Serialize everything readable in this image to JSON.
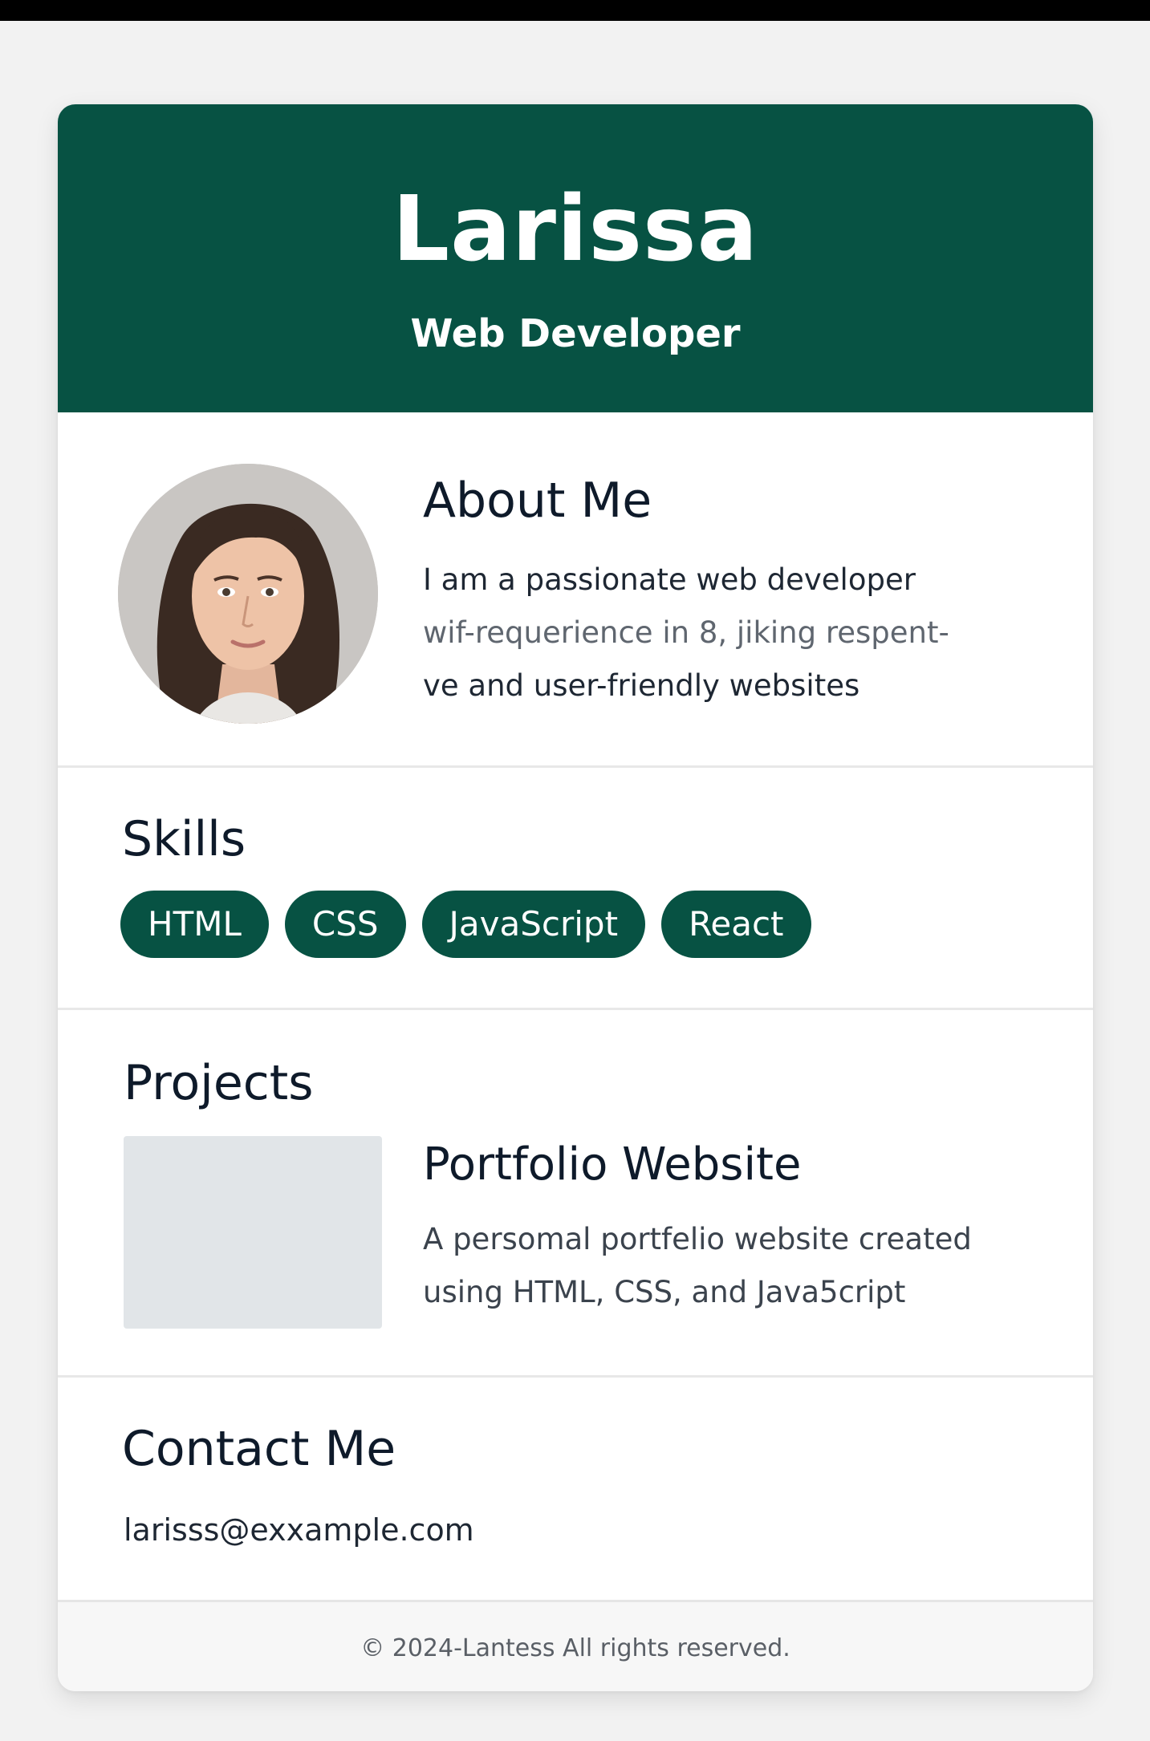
{
  "profile": {
    "name": "Larissa",
    "role": "Web Developer"
  },
  "about": {
    "title": "About Me",
    "lines": [
      "I am a passionate web developer",
      "wif-requerience in 8, jiking respent-",
      "ve and user-friendly websites"
    ]
  },
  "skills": {
    "title": "Skills",
    "items": [
      "HTML",
      "CSS",
      "JavaScript",
      "React"
    ]
  },
  "projects": {
    "title": "Projects",
    "items": [
      {
        "title": "Portfolio Website",
        "description_lines": [
          "A persomal portfelio website created",
          "using HTML, CSS, and Java5cript"
        ]
      }
    ]
  },
  "contact": {
    "title": "Contact Me",
    "email": "larisss@exxample.com"
  },
  "footer": {
    "text": "© 2024-Lantess All rights reserved."
  },
  "colors": {
    "brand": "#075243",
    "page_background": "#f2f2f2",
    "card_background": "#ffffff",
    "heading_text": "#0e1a2a"
  }
}
